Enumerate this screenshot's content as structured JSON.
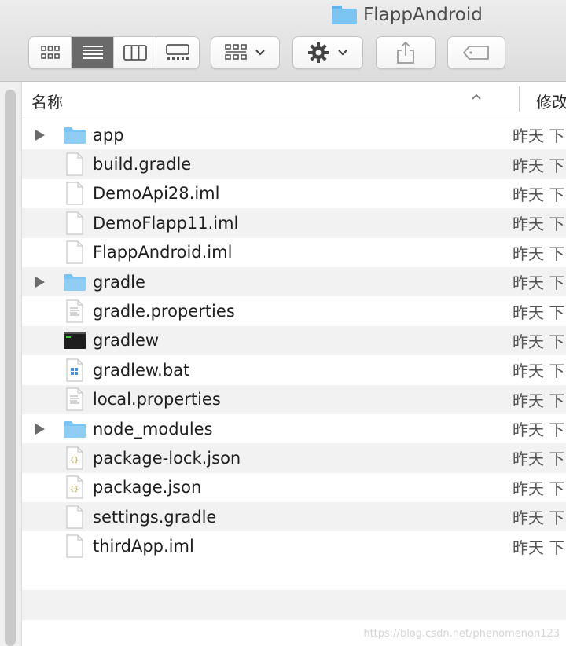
{
  "window": {
    "title": "FlappAndroid"
  },
  "toolbar": {
    "view_modes": [
      "icon-view",
      "list-view",
      "column-view",
      "gallery-view"
    ],
    "active_view": "list-view"
  },
  "columns": {
    "name": "名称",
    "date_modified": "修改日"
  },
  "files": [
    {
      "name": "app",
      "kind": "folder",
      "expandable": true,
      "date": "昨天 下"
    },
    {
      "name": "build.gradle",
      "kind": "doc",
      "expandable": false,
      "date": "昨天 下"
    },
    {
      "name": "DemoApi28.iml",
      "kind": "doc",
      "expandable": false,
      "date": "昨天 下"
    },
    {
      "name": "DemoFlapp11.iml",
      "kind": "doc",
      "expandable": false,
      "date": "昨天 下"
    },
    {
      "name": "FlappAndroid.iml",
      "kind": "doc",
      "expandable": false,
      "date": "昨天 下"
    },
    {
      "name": "gradle",
      "kind": "folder",
      "expandable": true,
      "date": "昨天 下"
    },
    {
      "name": "gradle.properties",
      "kind": "text",
      "expandable": false,
      "date": "昨天 下"
    },
    {
      "name": "gradlew",
      "kind": "exec",
      "expandable": false,
      "date": "昨天 下"
    },
    {
      "name": "gradlew.bat",
      "kind": "bat",
      "expandable": false,
      "date": "昨天 下"
    },
    {
      "name": "local.properties",
      "kind": "text",
      "expandable": false,
      "date": "昨天 下"
    },
    {
      "name": "node_modules",
      "kind": "folder",
      "expandable": true,
      "date": "昨天 下"
    },
    {
      "name": "package-lock.json",
      "kind": "json",
      "expandable": false,
      "date": "昨天 下"
    },
    {
      "name": "package.json",
      "kind": "json",
      "expandable": false,
      "date": "昨天 下"
    },
    {
      "name": "settings.gradle",
      "kind": "doc",
      "expandable": false,
      "date": "昨天 下"
    },
    {
      "name": "thirdApp.iml",
      "kind": "doc",
      "expandable": false,
      "date": "昨天 下"
    }
  ],
  "watermark": "https://blog.csdn.net/phenomenon123",
  "colors": {
    "folder": "#7cc4f2",
    "active_segment": "#6a6a6a",
    "row_alt": "#f2f2f2"
  }
}
